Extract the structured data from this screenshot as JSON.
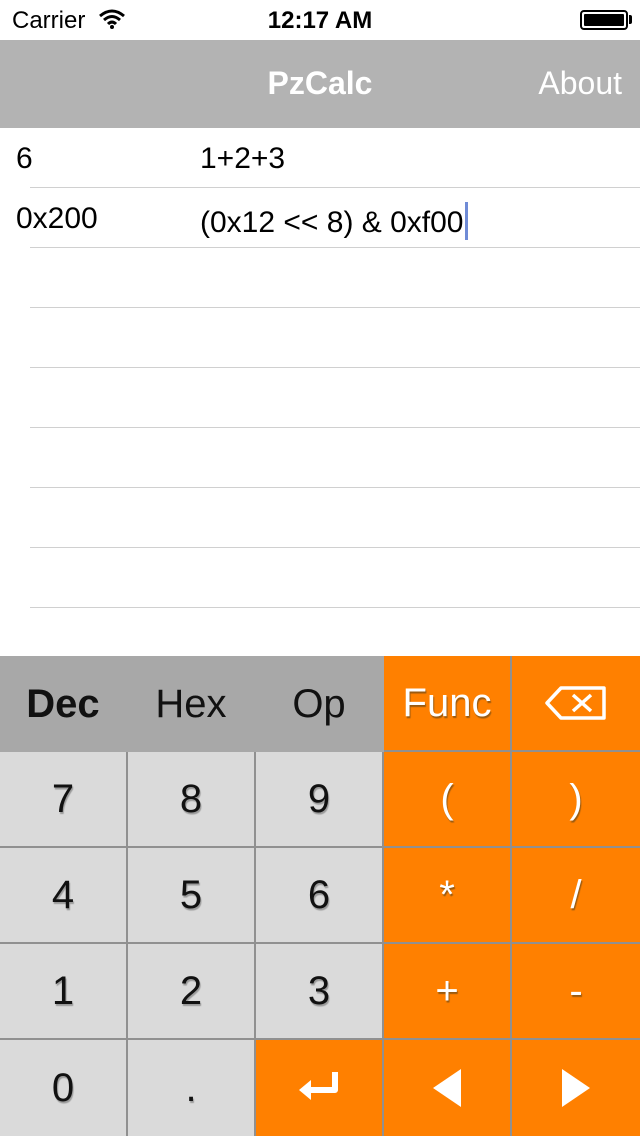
{
  "status_bar": {
    "carrier": "Carrier",
    "time": "12:17 AM",
    "icons": [
      "wifi-icon",
      "battery-icon"
    ]
  },
  "nav": {
    "title": "PzCalc",
    "about_label": "About"
  },
  "history": [
    {
      "result": "6",
      "expression": "1+2+3"
    },
    {
      "result": "0x200",
      "expression": "(0x12 << 8) & 0xf00"
    }
  ],
  "keypad": {
    "modes": [
      {
        "label": "Dec",
        "active": true
      },
      {
        "label": "Hex",
        "active": false
      },
      {
        "label": "Op",
        "active": false
      }
    ],
    "func_label": "Func",
    "backspace_icon": "backspace-icon",
    "digits": [
      "7",
      "8",
      "9",
      "4",
      "5",
      "6",
      "1",
      "2",
      "3",
      "0",
      "."
    ],
    "operators": [
      "(",
      ")",
      "*",
      "/",
      "+",
      "-"
    ],
    "enter_icon": "enter-icon",
    "left_icon": "arrow-left-icon",
    "right_icon": "arrow-right-icon"
  },
  "colors": {
    "nav_bg": "#b3b3b3",
    "orange_key": "#ff8000",
    "gray_key": "#dadada",
    "mode_bar": "#a8a8a8",
    "cursor": "#6f8bd6"
  }
}
